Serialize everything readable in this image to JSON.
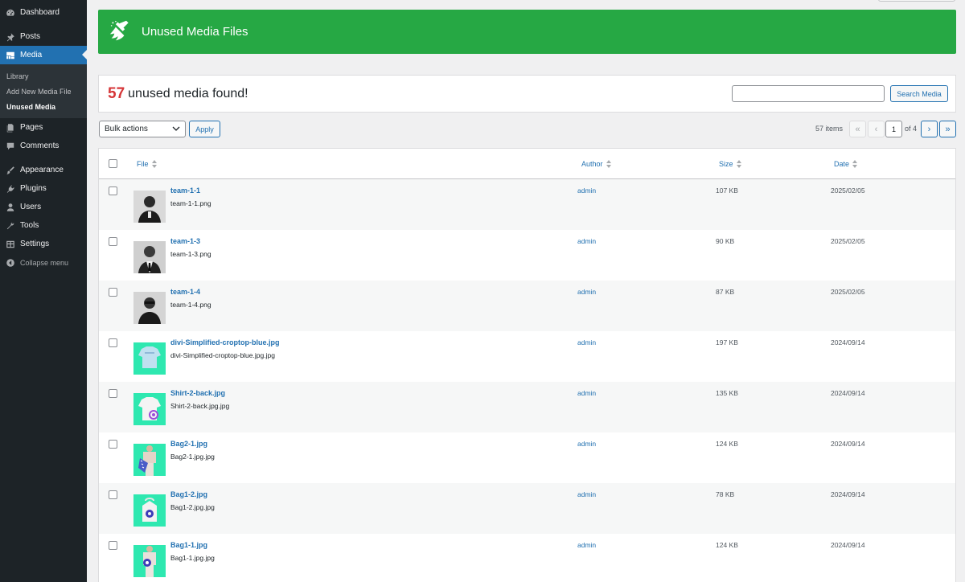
{
  "sidebar": {
    "items": [
      {
        "label": "Dashboard",
        "icon": "dashboard-icon"
      },
      {
        "label": "Posts",
        "icon": "pin-icon"
      },
      {
        "label": "Media",
        "icon": "media-icon"
      },
      {
        "label": "Pages",
        "icon": "pages-icon"
      },
      {
        "label": "Comments",
        "icon": "comments-icon"
      },
      {
        "label": "Appearance",
        "icon": "brush-icon"
      },
      {
        "label": "Plugins",
        "icon": "plugin-icon"
      },
      {
        "label": "Users",
        "icon": "users-icon"
      },
      {
        "label": "Tools",
        "icon": "wrench-icon"
      },
      {
        "label": "Settings",
        "icon": "settings-icon"
      },
      {
        "label": "Collapse menu",
        "icon": "collapse-icon"
      }
    ],
    "submenu": [
      "Library",
      "Add New Media File",
      "Unused Media"
    ]
  },
  "banner": {
    "title": "Unused Media Files",
    "icon": "broom-icon",
    "color": "#26a844"
  },
  "summary": {
    "count": "57",
    "text": "unused media found!"
  },
  "search": {
    "button": "Search Media",
    "value": ""
  },
  "bulk": {
    "selected": "Bulk actions",
    "apply": "Apply"
  },
  "pagination": {
    "items": "57 items",
    "first": "«",
    "prev": "‹",
    "current": "1",
    "of": "of 4",
    "next": "›",
    "last": "»"
  },
  "table": {
    "headers": {
      "file": "File",
      "author": "Author",
      "size": "Size",
      "date": "Date"
    },
    "rows": [
      {
        "title": "team-1-1",
        "file": "team-1-1.png",
        "author": "admin",
        "size": "107 KB",
        "date": "2025/02/05"
      },
      {
        "title": "team-1-3",
        "file": "team-1-3.png",
        "author": "admin",
        "size": "90 KB",
        "date": "2025/02/05"
      },
      {
        "title": "team-1-4",
        "file": "team-1-4.png",
        "author": "admin",
        "size": "87 KB",
        "date": "2025/02/05"
      },
      {
        "title": "divi-Simplified-croptop-blue.jpg",
        "file": "divi-Simplified-croptop-blue.jpg.jpg",
        "author": "admin",
        "size": "197 KB",
        "date": "2024/09/14"
      },
      {
        "title": "Shirt-2-back.jpg",
        "file": "Shirt-2-back.jpg.jpg",
        "author": "admin",
        "size": "135 KB",
        "date": "2024/09/14"
      },
      {
        "title": "Bag2-1.jpg",
        "file": "Bag2-1.jpg.jpg",
        "author": "admin",
        "size": "124 KB",
        "date": "2024/09/14"
      },
      {
        "title": "Bag1-2.jpg",
        "file": "Bag1-2.jpg.jpg",
        "author": "admin",
        "size": "78 KB",
        "date": "2024/09/14"
      },
      {
        "title": "Bag1-1.jpg",
        "file": "Bag1-1.jpg.jpg",
        "author": "admin",
        "size": "124 KB",
        "date": "2024/09/14"
      }
    ]
  }
}
